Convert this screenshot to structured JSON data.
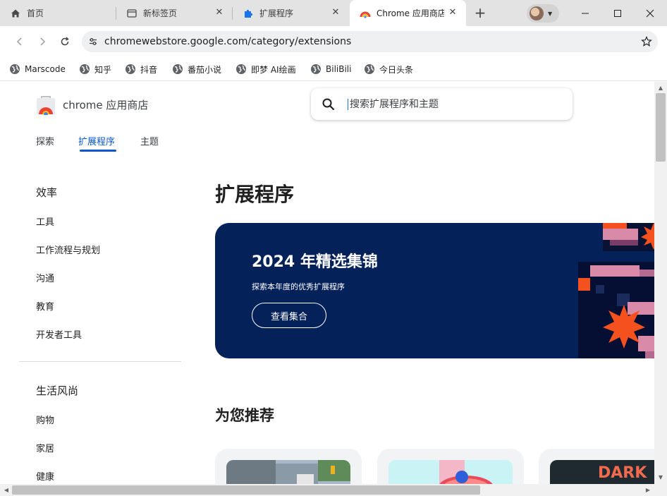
{
  "tabs": [
    {
      "title": "首页",
      "icon": "home-icon"
    },
    {
      "title": "新标签页",
      "icon": "newtab-page-icon"
    },
    {
      "title": "扩展程序",
      "icon": "puzzle-icon"
    },
    {
      "title": "Chrome 应用商店",
      "icon": "chrome-webstore-icon",
      "active": true
    }
  ],
  "toolbar": {
    "url": "chromewebstore.google.com/category/extensions"
  },
  "bookmarks": [
    "Marscode",
    "知乎",
    "抖音",
    "番茄小说",
    "即梦 AI绘画",
    "BiliBili",
    "今日头条"
  ],
  "store": {
    "name": "chrome 应用商店",
    "search_placeholder": "搜索扩展程序和主题",
    "nav": [
      "探索",
      "扩展程序",
      "主题"
    ]
  },
  "sidebar": {
    "group1": {
      "heading": "效率",
      "items": [
        "工具",
        "工作流程与规划",
        "沟通",
        "教育",
        "开发者工具"
      ]
    },
    "group2": {
      "heading": "生活风尚",
      "items": [
        "购物",
        "家居",
        "健康"
      ]
    }
  },
  "main": {
    "title": "扩展程序",
    "banner": {
      "title": "2024 年精选集锦",
      "subtitle": "探索本年度的优秀扩展程序",
      "button": "查看集合"
    },
    "section_title": "为您推荐",
    "cards": [
      {
        "thumb": "street-scene"
      },
      {
        "thumb": "ball-game"
      },
      {
        "thumb_text": "DARK"
      }
    ]
  },
  "colors": {
    "accent": "#0b57d0",
    "banner_bg": "#04215a",
    "banner_art_orange": "#f4511e",
    "banner_art_pink": "#d98aa8"
  }
}
